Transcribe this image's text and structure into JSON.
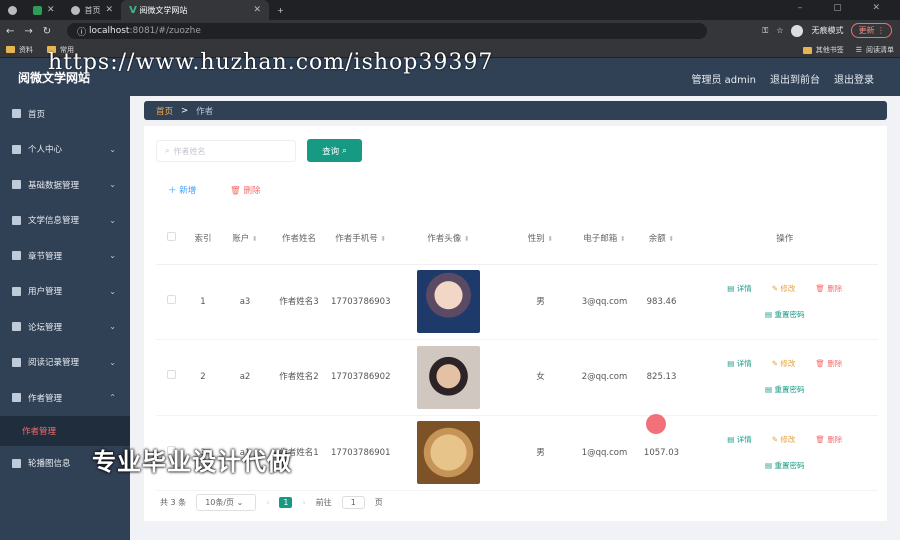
{
  "browser": {
    "tabs": [
      {
        "label": ""
      },
      {
        "label": "首页"
      },
      {
        "label": "阅微文学网站"
      }
    ],
    "url_host": "localhost",
    "url_rest": ":8081/#/zuozhe",
    "profile_label": "无痕模式",
    "update_label": "更新",
    "bookmarks": [
      "资料",
      "常用"
    ],
    "bookmarks_right": [
      "其他书签",
      "阅读清单"
    ]
  },
  "watermark_url": "https://www.huzhan.com/ishop39397",
  "header": {
    "title": "阅微文学网站",
    "admin_label": "管理员 admin",
    "back_label": "退出到前台",
    "logout_label": "退出登录"
  },
  "sidebar": {
    "items": [
      {
        "label": "首页"
      },
      {
        "label": "个人中心"
      },
      {
        "label": "基础数据管理"
      },
      {
        "label": "文学信息管理"
      },
      {
        "label": "章节管理"
      },
      {
        "label": "用户管理"
      },
      {
        "label": "论坛管理"
      },
      {
        "label": "阅读记录管理"
      },
      {
        "label": "作者管理"
      }
    ],
    "sub_item": "作者管理",
    "last_item": "轮播图信息"
  },
  "breadcrumb": {
    "home": "首页",
    "sep": ">",
    "current": "作者"
  },
  "search": {
    "placeholder": "作者姓名",
    "button": "查询"
  },
  "actions": {
    "add": "新增",
    "delete": "删除"
  },
  "table": {
    "headers": {
      "index": "索引",
      "account": "账户",
      "name": "作者姓名",
      "phone": "作者手机号",
      "avatar": "作者头像",
      "gender": "性别",
      "email": "电子邮箱",
      "balance": "余额",
      "ops": "操作"
    },
    "rows": [
      {
        "index": "1",
        "account": "a3",
        "name": "作者姓名3",
        "phone": "17703786903",
        "gender": "男",
        "email": "3@qq.com",
        "balance": "983.46"
      },
      {
        "index": "2",
        "account": "a2",
        "name": "作者姓名2",
        "phone": "17703786902",
        "gender": "女",
        "email": "2@qq.com",
        "balance": "825.13"
      },
      {
        "index": "3",
        "account": "a1",
        "name": "作者姓名1",
        "phone": "17703786901",
        "gender": "男",
        "email": "1@qq.com",
        "balance": "1057.03"
      }
    ],
    "op_labels": {
      "detail": "详情",
      "edit": "修改",
      "remove": "删除",
      "reset": "重置密码"
    }
  },
  "pager": {
    "total": "共 3 条",
    "page_size": "10条/页",
    "current": "1",
    "goto": "前往",
    "goto_value": "1",
    "page_unit": "页"
  },
  "overlay_text": "专业毕业设计代做"
}
